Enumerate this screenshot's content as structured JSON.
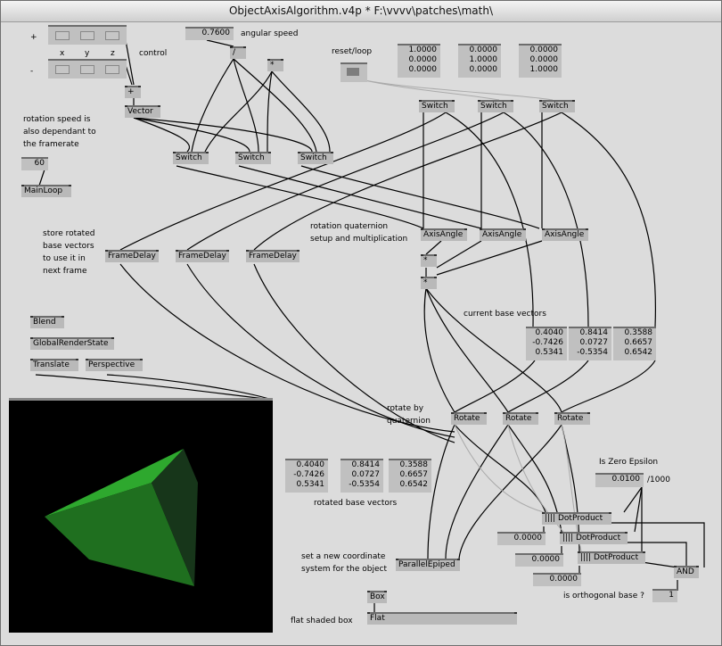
{
  "window": {
    "title": "ObjectAxisAlgorithm.v4p *  F:\\vvvv\\patches\\math\\"
  },
  "labels": {
    "plus": "+",
    "minus": "-",
    "x": "x",
    "y": "y",
    "z": "z",
    "control": "control",
    "angular_speed": "angular speed",
    "reset_loop": "reset/loop",
    "rot_speed_1": "rotation speed is",
    "rot_speed_2": "also dependant to",
    "rot_speed_3": "the framerate",
    "store_1": "store rotated",
    "store_2": "base vectors",
    "store_3": "to use it in",
    "store_4": "next frame",
    "quat_1": "rotation quaternion",
    "quat_2": "setup and multiplication",
    "current_base": "current base vectors",
    "rotate_by_1": "rotate by",
    "rotate_by_2": "quaternion",
    "rotated_base": "rotated base vectors",
    "is_zero": "Is Zero Epsilon",
    "per_1000": "/1000",
    "set_new_1": "set a new coordinate",
    "set_new_2": "system for the object",
    "flat_shaded": "flat shaded box",
    "orthogonal": "is orthogonal base ?"
  },
  "nodes": {
    "add": "+",
    "vector": "Vector",
    "div": "/",
    "mul": "*",
    "switch": "Switch",
    "mainloop": "MainLoop",
    "framedelay": "FrameDelay",
    "axisangle": "AxisAngle",
    "quatmul": "*",
    "blend": "Blend",
    "globalrender": "GlobalRenderState",
    "translate": "Translate",
    "perspective": "Perspective",
    "rotate": "Rotate",
    "dotproduct": "|||| DotProduct",
    "parallel": "ParallelEpiped",
    "and": "AND",
    "box": "Box",
    "flat": "Flat"
  },
  "values": {
    "angular_speed": "0.7600",
    "framerate": "60",
    "axis1": [
      "1.0000",
      "0.0000",
      "0.0000"
    ],
    "axis2": [
      "0.0000",
      "1.0000",
      "0.0000"
    ],
    "axis3": [
      "0.0000",
      "0.0000",
      "1.0000"
    ],
    "current1": [
      "0.4040",
      "-0.7426",
      "0.5341"
    ],
    "current2": [
      "0.8414",
      "0.0727",
      "-0.5354"
    ],
    "current3": [
      "0.3588",
      "0.6657",
      "0.6542"
    ],
    "rotated1": [
      "0.4040",
      "-0.7426",
      "0.5341"
    ],
    "rotated2": [
      "0.8414",
      "0.0727",
      "-0.5354"
    ],
    "rotated3": [
      "0.3588",
      "0.6657",
      "0.6542"
    ],
    "epsilon": "0.0100",
    "dot1": "0.0000",
    "dot2": "0.0000",
    "dot3": "0.0000",
    "and_out": "1"
  },
  "colors": {
    "cube_face_top": "#2ea82e",
    "cube_face_left": "#1f7a1f",
    "cube_face_right": "#1a3a1a"
  }
}
